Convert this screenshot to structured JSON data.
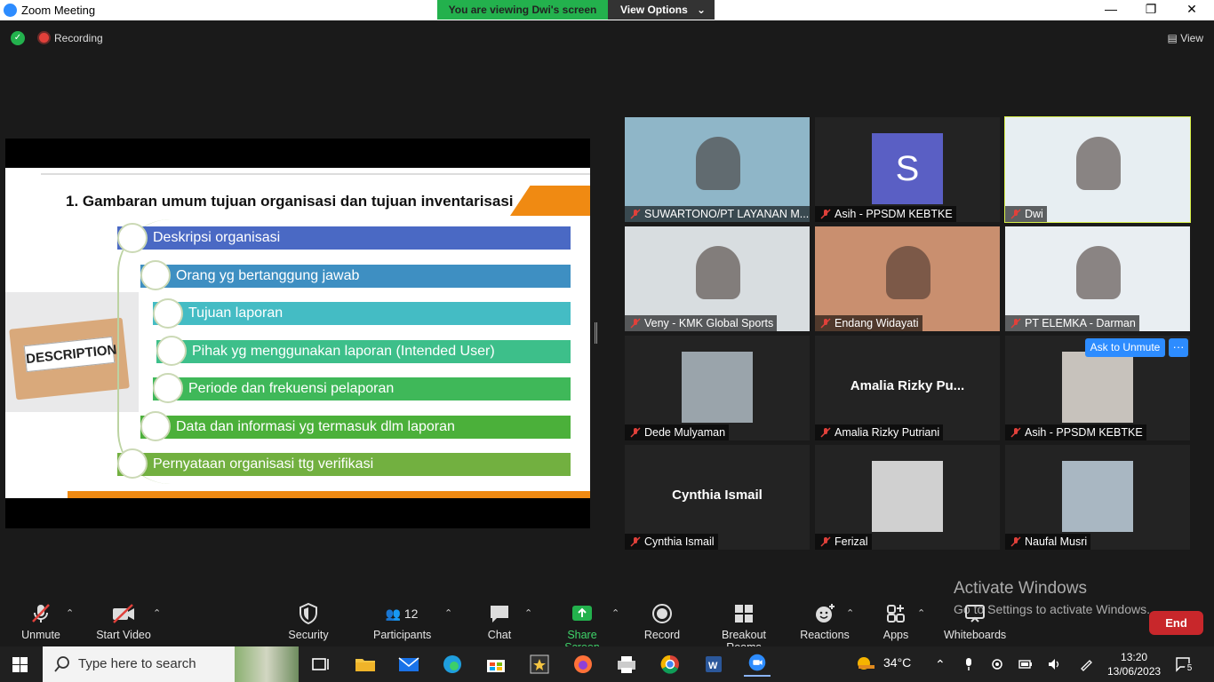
{
  "window": {
    "title": "Zoom Meeting",
    "banner": "You are viewing Dwi's screen",
    "view_options": "View Options",
    "recording": "Recording",
    "top_view": "View"
  },
  "slide": {
    "title": "1. Gambaran umum tujuan organisasi dan tujuan inventarisasi",
    "description_card": "DESCRIPTION",
    "items": [
      {
        "label": "Deskripsi organisasi",
        "color": "#4a69c4"
      },
      {
        "label": "Orang yg bertanggung jawab",
        "color": "#3e8fc2"
      },
      {
        "label": "Tujuan laporan",
        "color": "#44bcc4"
      },
      {
        "label": "Pihak yg menggunakan laporan (Intended User)",
        "color": "#3dbf8a"
      },
      {
        "label": "Periode dan frekuensi pelaporan",
        "color": "#3fb859"
      },
      {
        "label": "Data dan informasi yg termasuk dlm laporan",
        "color": "#4bb03a"
      },
      {
        "label": "Pernyataan organisasi ttg verifikasi",
        "color": "#72b040"
      }
    ]
  },
  "participants": [
    {
      "name": "SUWARTONO/PT LAYANAN M...",
      "kind": "video",
      "bg": "#8fb6c8",
      "big_name": ""
    },
    {
      "name": "Asih - PPSDM KEBTKE",
      "kind": "initial",
      "initial": "S",
      "bg": "#5a5fc4",
      "big_name": ""
    },
    {
      "name": "Dwi",
      "kind": "video",
      "bg": "#e7eef2",
      "big_name": "",
      "speaker": true
    },
    {
      "name": "Veny - KMK Global Sports",
      "kind": "video",
      "bg": "#d8dde0",
      "big_name": ""
    },
    {
      "name": "Endang Widayati",
      "kind": "video",
      "bg": "#c98f6f",
      "big_name": ""
    },
    {
      "name": "PT ELEMKA - Darman",
      "kind": "video",
      "bg": "#e9eef2",
      "big_name": ""
    },
    {
      "name": "Dede Mulyaman",
      "kind": "photo",
      "bg": "#9aa4ab",
      "big_name": ""
    },
    {
      "name": "Amalia Rizky Putriani",
      "kind": "text",
      "bg": "#232323",
      "big_name": "Amalia  Rizky  Pu..."
    },
    {
      "name": "Asih - PPSDM KEBTKE",
      "kind": "photo",
      "bg": "#c7c2bc",
      "big_name": ""
    },
    {
      "name": "Cynthia Ismail",
      "kind": "text",
      "bg": "#232323",
      "big_name": "Cynthia Ismail"
    },
    {
      "name": "Ferizal",
      "kind": "photo",
      "bg": "#d0d0d0",
      "big_name": ""
    },
    {
      "name": "Naufal Musri",
      "kind": "photo",
      "bg": "#a9b7c2",
      "big_name": ""
    }
  ],
  "ask_unmute": {
    "label": "Ask to Unmute",
    "more": "···"
  },
  "toolbar": {
    "unmute": "Unmute",
    "start_video": "Start Video",
    "security": "Security",
    "participants": "Participants",
    "participants_count": "12",
    "chat": "Chat",
    "share_screen": "Share Screen",
    "record": "Record",
    "breakout_rooms": "Breakout Rooms",
    "reactions": "Reactions",
    "apps": "Apps",
    "whiteboards": "Whiteboards",
    "end": "End"
  },
  "watermark": {
    "line1": "Activate Windows",
    "line2": "Go to Settings to activate Windows."
  },
  "taskbar": {
    "search_placeholder": "Type here to search",
    "temperature": "34°C",
    "time": "13:20",
    "date": "13/06/2023",
    "notifications": "5"
  }
}
